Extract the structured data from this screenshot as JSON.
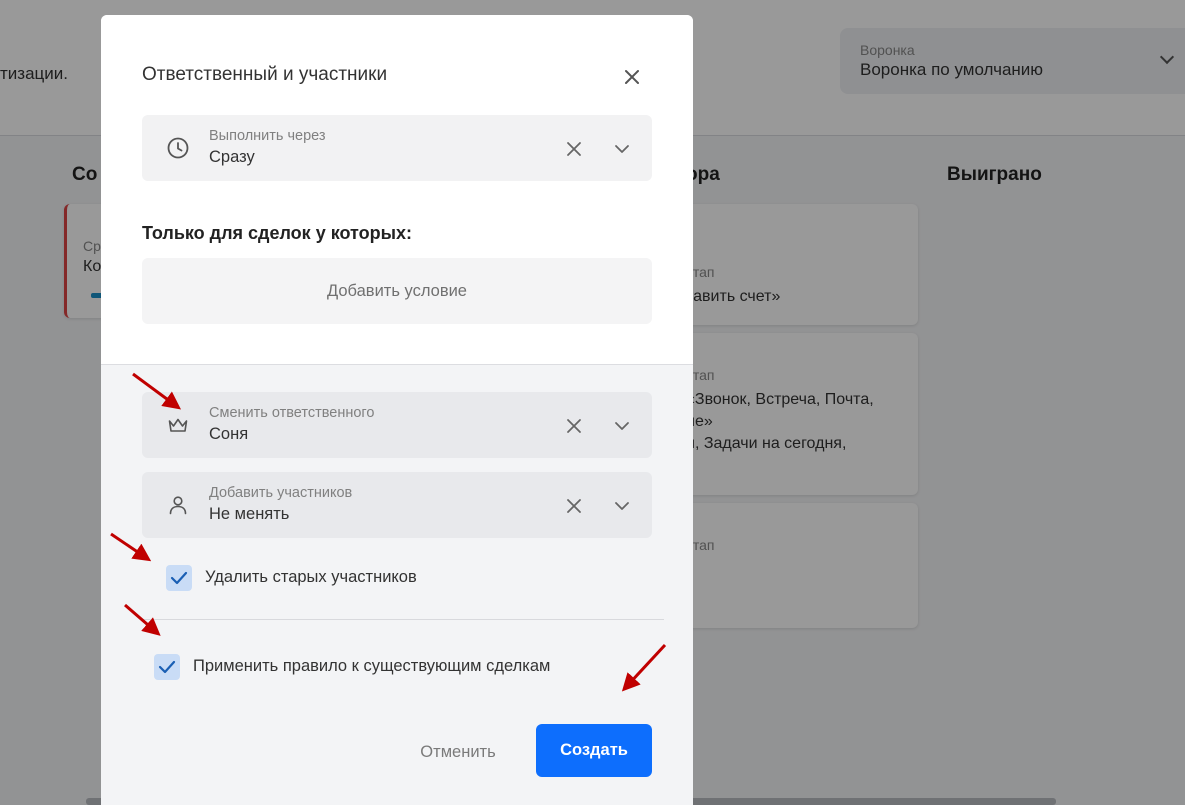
{
  "background": {
    "header_text": "тизации.",
    "funnel": {
      "label": "Воронка",
      "value": "Воронка по умолчанию"
    },
    "columns": [
      {
        "title": "Co"
      },
      {
        "title": "ора"
      },
      {
        "title": "Выиграно"
      }
    ],
    "left_card": {
      "line1": "Ср",
      "line2": "Ко"
    },
    "cards": [
      {
        "label": "этап",
        "value": "тавить счет»"
      },
      {
        "label": "этап",
        "value": "«Звонок, Встреча, Почта,",
        "value2": "ие»",
        "value3": "и, Задачи на сегодня,"
      },
      {
        "label": "этап"
      }
    ]
  },
  "modal": {
    "title": "Ответственный и участники",
    "execute": {
      "label": "Выполнить через",
      "value": "Сразу",
      "icon": "clock-icon"
    },
    "conditions_title": "Только для сделок у которых:",
    "add_condition": "Добавить условие",
    "change_owner": {
      "label": "Сменить ответственного",
      "value": "Соня",
      "icon": "crown-icon"
    },
    "add_participants": {
      "label": "Добавить участников",
      "value": "Не менять",
      "icon": "user-icon"
    },
    "remove_old": {
      "label": "Удалить старых участников",
      "checked": true
    },
    "apply_existing": {
      "label": "Применить правило к существующим сделкам",
      "checked": true
    },
    "cancel_label": "Отменить",
    "create_label": "Создать"
  },
  "colors": {
    "primary": "#0d6efd",
    "checkbox_bg": "#c9dcf6",
    "check_mark": "#1a5fb4",
    "annotation_arrow": "#c00000"
  }
}
